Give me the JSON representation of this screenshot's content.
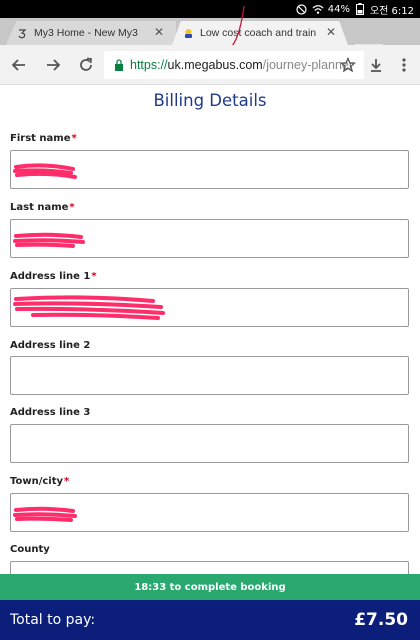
{
  "status_bar": {
    "battery": "44%",
    "time": "오전 6:12",
    "icons": [
      "do-not-disturb-icon",
      "wifi-icon",
      "battery-icon"
    ]
  },
  "browser": {
    "tabs": [
      {
        "title": "My3 Home - New My3",
        "favicon": "three-logo-icon",
        "active": false
      },
      {
        "title": "Low cost coach and train trav",
        "favicon": "megabus-icon",
        "active": true
      }
    ],
    "url": {
      "scheme": "https://",
      "host": "uk.megabus.com",
      "path": "/journey-planner"
    }
  },
  "form": {
    "heading": "Billing Details",
    "required_marker": "*",
    "fields": [
      {
        "label": "First name",
        "required": true
      },
      {
        "label": "Last name",
        "required": true
      },
      {
        "label": "Address line 1",
        "required": true
      },
      {
        "label": "Address line 2",
        "required": false
      },
      {
        "label": "Address line 3",
        "required": false
      },
      {
        "label": "Town/city",
        "required": true
      },
      {
        "label": "County",
        "required": false
      }
    ]
  },
  "booking": {
    "countdown_text": "18:33 to complete booking",
    "total_label": "Total to pay:",
    "total_amount": "£7.50"
  },
  "colors": {
    "heading": "#1f3a8a",
    "required": "#d0021b",
    "countdown_bg": "#29a870",
    "total_bg": "#0b1f7a",
    "redaction": "#ff2d6a"
  }
}
